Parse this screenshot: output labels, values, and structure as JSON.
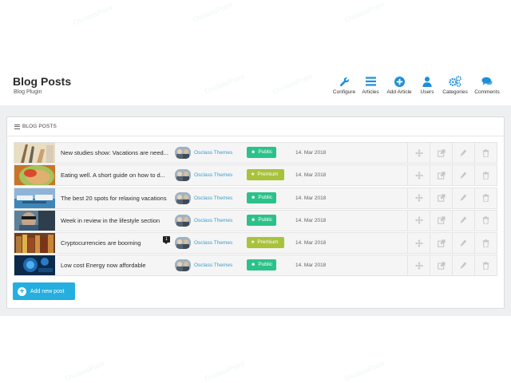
{
  "header": {
    "title": "Blog Posts",
    "subtitle": "Blog Plugin"
  },
  "toolbar": [
    {
      "label": "Configure",
      "icon": "wrench-icon"
    },
    {
      "label": "Articles",
      "icon": "list-icon"
    },
    {
      "label": "Add Article",
      "icon": "plus-circle-icon"
    },
    {
      "label": "Users",
      "icon": "user-icon"
    },
    {
      "label": "Categories",
      "icon": "cogs-icon"
    },
    {
      "label": "Comments",
      "icon": "comments-icon"
    }
  ],
  "panel": {
    "title": "BLOG POSTS"
  },
  "posts": [
    {
      "title": "New studies show: Vacations are need...",
      "author": "Osclass Themes",
      "badge": "Public",
      "date": "14. Mar 2018",
      "comments": ""
    },
    {
      "title": "Eating well. A short guide on how to d...",
      "author": "Osclass Themes",
      "badge": "Premium",
      "date": "14. Mar 2018",
      "comments": ""
    },
    {
      "title": "The best 20 spots for relaxing vacations",
      "author": "Osclass Themes",
      "badge": "Public",
      "date": "14. Mar 2018",
      "comments": ""
    },
    {
      "title": "Week in review in the lifestyle section",
      "author": "Osclass Themes",
      "badge": "Public",
      "date": "14. Mar 2018",
      "comments": ""
    },
    {
      "title": "Cryptocurrencies are booming",
      "author": "Osclass Themes",
      "badge": "Premium",
      "date": "14. Mar 2018",
      "comments": "1"
    },
    {
      "title": "Low cost Energy now affordable",
      "author": "Osclass Themes",
      "badge": "Public",
      "date": "14. Mar 2018",
      "comments": ""
    }
  ],
  "add_button": {
    "label": "Add new post"
  },
  "colors": {
    "accent": "#25aee0",
    "toolbar_icon": "#1e8fd8",
    "public": "#2bc28a",
    "premium": "#a8c23c",
    "link": "#3a9bd0"
  },
  "watermark": "OsclassPoint"
}
